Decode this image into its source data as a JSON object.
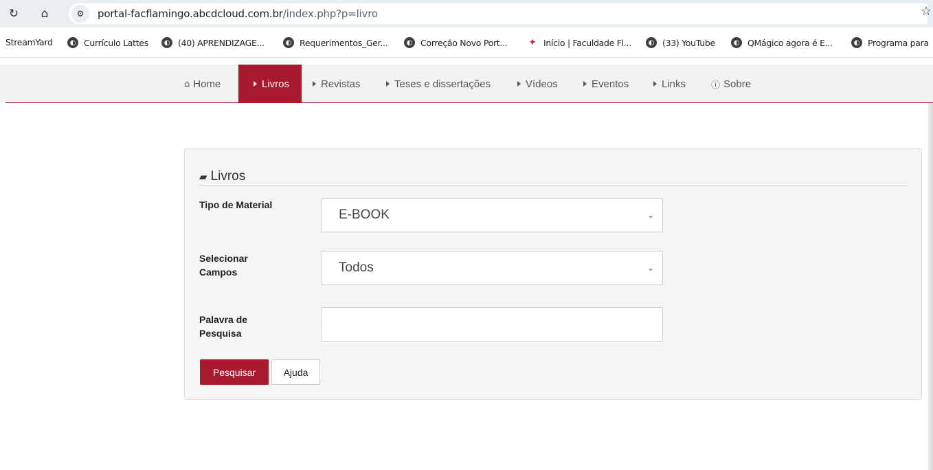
{
  "browser": {
    "reload_icon": "reload-icon",
    "home_icon": "home-icon",
    "site_settings_icon": "site-settings-icon",
    "url_main": "portal-facflamingo.abcdcloud.com.br",
    "url_path": "/index.php?p=livro",
    "bookmark_star_icon": "star-icon",
    "bookmarks": [
      {
        "label": "StreamYard",
        "icon": "none"
      },
      {
        "label": "Currículo Lattes",
        "icon": "globe-icon"
      },
      {
        "label": "(40) APRENDIZAGE...",
        "icon": "globe-icon"
      },
      {
        "label": "Requerimentos_Ger...",
        "icon": "globe-icon"
      },
      {
        "label": "Correção Novo Port...",
        "icon": "globe-icon"
      },
      {
        "label": "Início | Faculdade Fl...",
        "icon": "flamingo-icon"
      },
      {
        "label": "(33) YouTube",
        "icon": "globe-icon"
      },
      {
        "label": "QMágico agora é E...",
        "icon": "globe-icon"
      },
      {
        "label": "Programa para",
        "icon": "globe-icon"
      }
    ]
  },
  "nav": {
    "items": [
      {
        "label": "Home",
        "icon": "home-icon",
        "active": false
      },
      {
        "label": "Livros",
        "icon": "caret-right-icon",
        "active": true
      },
      {
        "label": "Revistas",
        "icon": "caret-right-icon",
        "active": false
      },
      {
        "label": "Teses e dissertações",
        "icon": "caret-right-icon",
        "active": false
      },
      {
        "label": "Vídeos",
        "icon": "caret-right-icon",
        "active": false
      },
      {
        "label": "Eventos",
        "icon": "caret-right-icon",
        "active": false
      },
      {
        "label": "Links",
        "icon": "caret-right-icon",
        "active": false
      },
      {
        "label": "Sobre",
        "icon": "info-icon",
        "active": false
      }
    ]
  },
  "form": {
    "legend": "Livros",
    "legend_icon": "book-icon",
    "tipo_label": "Tipo de Material",
    "tipo_value": "E-BOOK",
    "campos_label_1": "Selecionar",
    "campos_label_2": "Campos",
    "campos_value": "Todos",
    "palavra_label_1": "Palavra de",
    "palavra_label_2": "Pesquisa",
    "palavra_value": "",
    "search_button": "Pesquisar",
    "help_button": "Ajuda"
  },
  "colors": {
    "accent": "#a8182f",
    "nav_bg": "#f2f2f2",
    "panel_bg": "#f5f5f5"
  }
}
